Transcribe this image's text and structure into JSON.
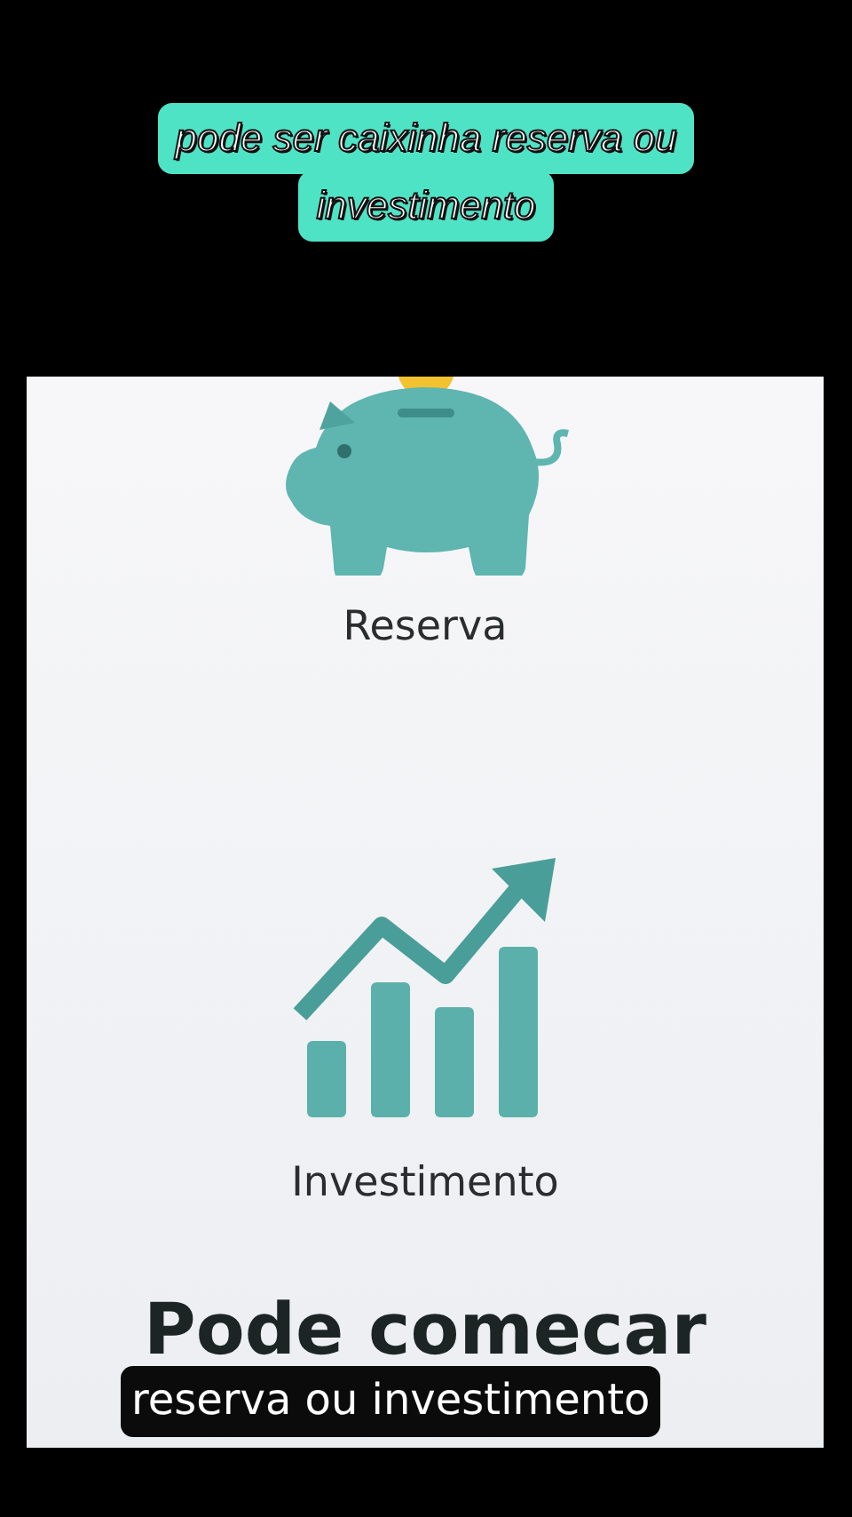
{
  "top_caption": {
    "lines": [
      "pode ser caixinha reserva ou",
      "investimento"
    ]
  },
  "options": [
    {
      "kind": "piggy",
      "label": "Reserva"
    },
    {
      "kind": "growth",
      "label": "Investimento"
    }
  ],
  "heading": "Pode comecar",
  "subtitle": "reserva ou investimento"
}
